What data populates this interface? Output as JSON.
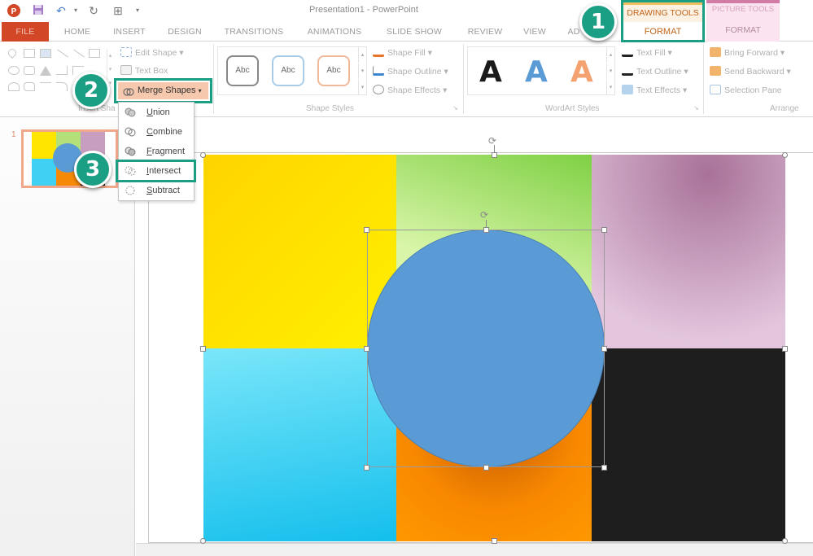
{
  "window": {
    "title": "Presentation1 - PowerPoint",
    "quick_access": [
      {
        "icon": "powerpoint-logo-icon"
      },
      {
        "icon": "save-icon"
      },
      {
        "icon": "undo-icon"
      },
      {
        "icon": "redo-icon"
      },
      {
        "icon": "start-from-beginning-icon"
      },
      {
        "icon": "customize-qat-icon"
      }
    ]
  },
  "tabs": [
    {
      "label": "FILE"
    },
    {
      "label": "HOME"
    },
    {
      "label": "INSERT"
    },
    {
      "label": "DESIGN"
    },
    {
      "label": "TRANSITIONS"
    },
    {
      "label": "ANIMATIONS"
    },
    {
      "label": "SLIDE SHOW"
    },
    {
      "label": "REVIEW"
    },
    {
      "label": "VIEW"
    },
    {
      "label": "AD"
    }
  ],
  "contextual_tabs": {
    "drawing_tools": {
      "group": "DRAWING TOOLS",
      "tab": "FORMAT"
    },
    "picture_tools": {
      "group": "PICTURE TOOLS",
      "tab": "FORMAT"
    }
  },
  "ribbon": {
    "insert_shapes": {
      "label": "Insert Sha",
      "edit_shape": "Edit Shape",
      "text_box": "Text Box",
      "merge_shapes": "Merge Shapes"
    },
    "shape_styles": {
      "label": "Shape Styles",
      "preview_text": "Abc",
      "shape_fill": "Shape Fill",
      "shape_outline": "Shape Outline",
      "shape_effects": "Shape Effects"
    },
    "wordart_styles": {
      "label": "WordArt Styles",
      "preview_letter": "A",
      "text_fill": "Text Fill",
      "text_outline": "Text Outline",
      "text_effects": "Text Effects"
    },
    "arrange": {
      "label": "Arrange",
      "bring_forward": "Bring Forward",
      "send_backward": "Send Backward",
      "selection_pane": "Selection Pane"
    }
  },
  "merge_menu": {
    "items": [
      {
        "label": "Union",
        "accel": "U",
        "rest": "nion"
      },
      {
        "label": "Combine",
        "accel": "C",
        "rest": "ombine"
      },
      {
        "label": "Fragment",
        "accel": "F",
        "rest": "ragment"
      },
      {
        "label": "Intersect",
        "accel": "I",
        "rest": "ntersect",
        "highlighted": true
      },
      {
        "label": "Subtract",
        "accel": "S",
        "rest": "ubtract"
      }
    ]
  },
  "callouts": [
    {
      "number": "1",
      "target": "drawing-tools-format-tab"
    },
    {
      "number": "2",
      "target": "merge-shapes-button"
    },
    {
      "number": "3",
      "target": "intersect-menu-item"
    }
  ],
  "slides_pane": {
    "slides": [
      {
        "number": "1"
      }
    ]
  },
  "colors": {
    "accent_teal": "#1a9e84",
    "file_tab": "#d24726",
    "circle_fill": "#5b9bd5",
    "yellow": "#ffe500",
    "green": "#b4e07a",
    "purple": "#c79ec0",
    "cyan": "#3fd0f3",
    "orange": "#f68a06",
    "black": "#1f1e1f"
  }
}
